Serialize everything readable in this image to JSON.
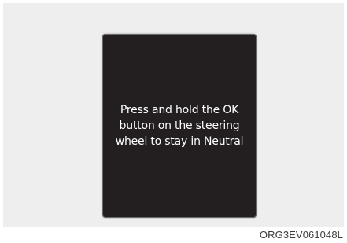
{
  "display": {
    "message": "Press and hold the OK\nbutton on the steering\nwheel to stay in Neutral"
  },
  "figure": {
    "code": "ORG3EV061048L"
  },
  "colors": {
    "panel_background": "#eeeeee",
    "display_background": "#231f20",
    "display_text": "#ffffff",
    "caption_text": "#3b3b3b"
  }
}
